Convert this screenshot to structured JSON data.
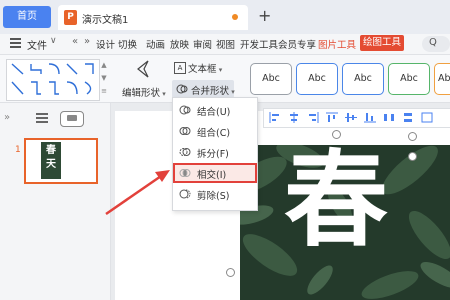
{
  "tabs": {
    "home": "首页",
    "doc_icon": "P",
    "doc_title": "演示文稿1",
    "new_tab": "+"
  },
  "ribbon": {
    "file": "文件",
    "file_chevron": "∨",
    "nav_prev": "«",
    "nav_next": "»",
    "items": [
      "设计",
      "切换",
      "动画",
      "放映",
      "审阅",
      "视图",
      "开发工具",
      "会员专享",
      "图片工具",
      "绘图工具"
    ],
    "active": "绘图工具",
    "search_label": "Q"
  },
  "toolbar": {
    "edit_shape": "编辑形状",
    "textbox": "文本框",
    "textbox_icon": "A",
    "merge_shape": "合并形状",
    "styles": [
      {
        "label": "Abc",
        "border": "#9aa0a8"
      },
      {
        "label": "Abc",
        "border": "#4a86e8"
      },
      {
        "label": "Abc",
        "border": "#4a86e8"
      },
      {
        "label": "Abc",
        "border": "#56b56a"
      },
      {
        "label": "Abc",
        "border": "#f0a040"
      }
    ]
  },
  "merge_menu": {
    "items": [
      "结合(U)",
      "组合(C)",
      "拆分(F)",
      "相交(I)",
      "剪除(S)"
    ],
    "highlighted": "相交(I)"
  },
  "left_panel": {
    "collapse": "»",
    "slide_number": "1",
    "thumb_text": "春天"
  },
  "slide": {
    "text": "春"
  },
  "colors": {
    "accent": "#e44b32",
    "highlight_border": "#e2413b",
    "home_tab": "#4a82f0",
    "photo_bg": "#243a2b"
  }
}
